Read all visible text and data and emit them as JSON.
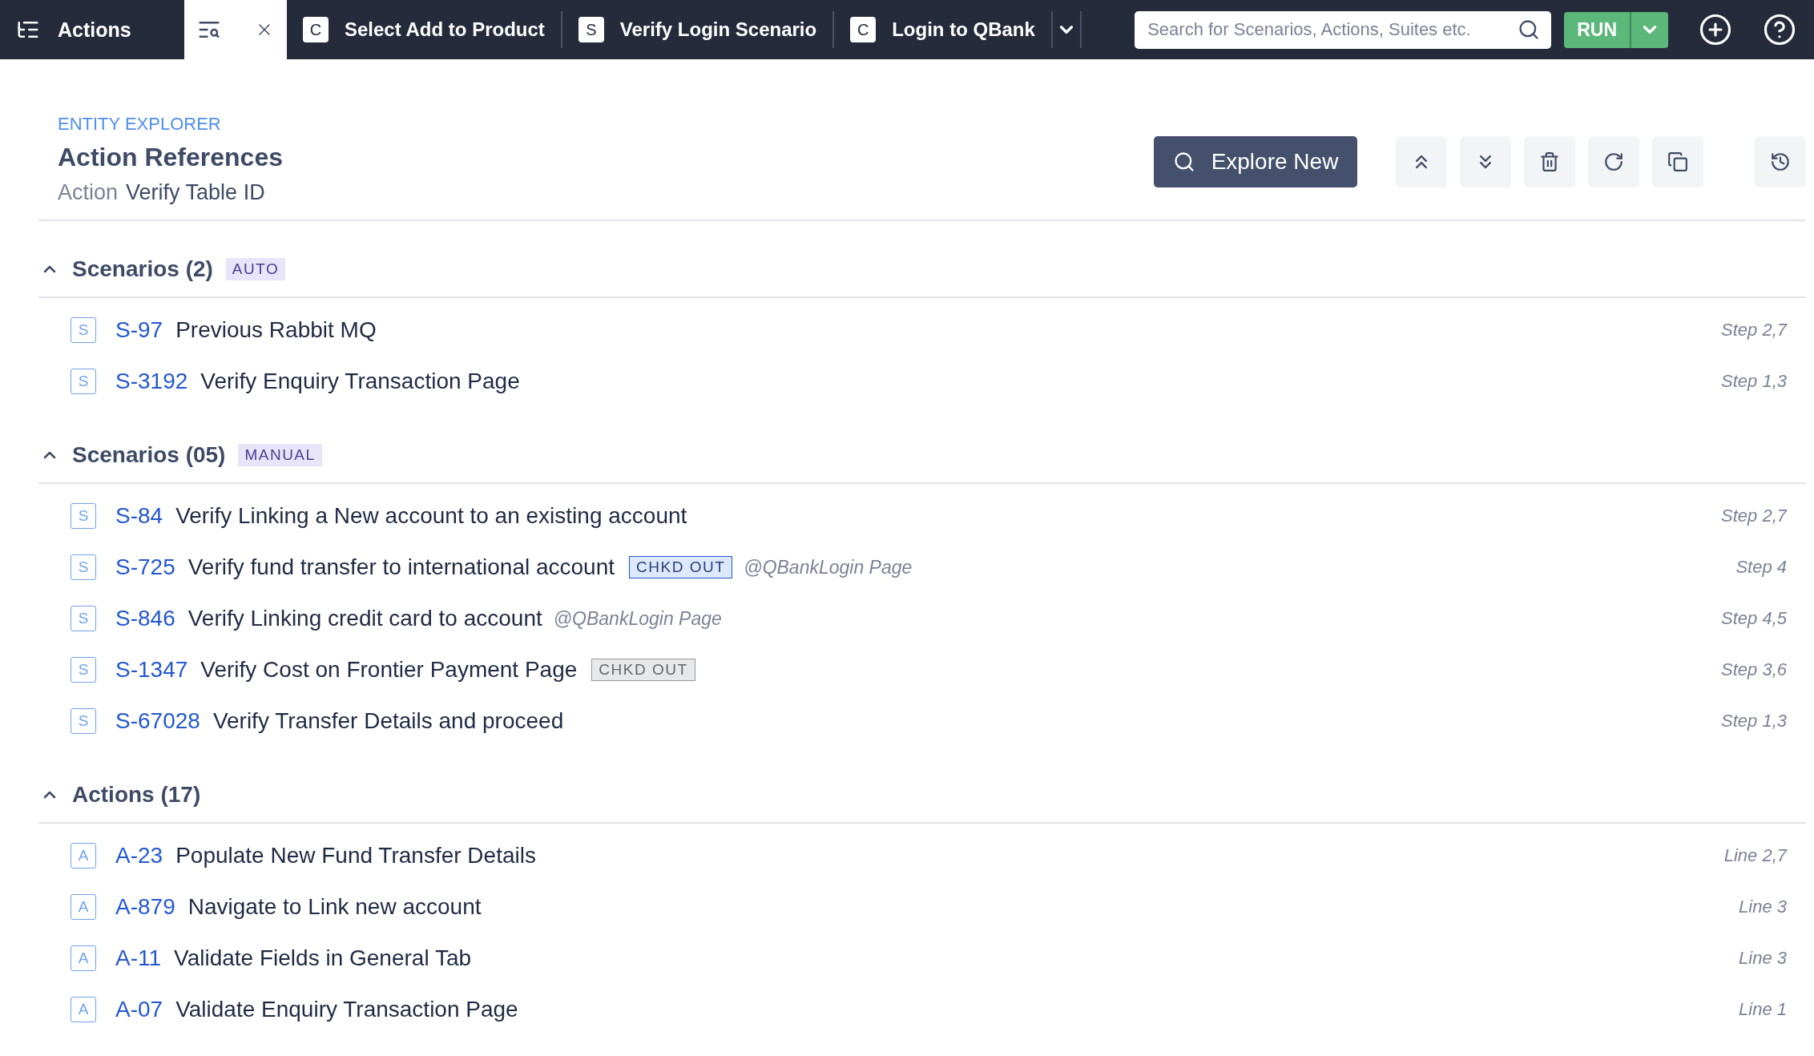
{
  "top_bar": {
    "menu": {
      "label": "Actions"
    },
    "tabs": [
      {
        "kind": "explorer",
        "selected": true
      },
      {
        "kind": "entity",
        "badge": "C",
        "label": "Select Add to Product",
        "selected": false
      },
      {
        "kind": "entity",
        "badge": "S",
        "label": "Verify Login Scenario",
        "selected": false
      },
      {
        "kind": "entity",
        "badge": "C",
        "label": "Login to QBank",
        "selected": false
      }
    ],
    "search": {
      "placeholder": "Search for Scenarios, Actions, Suites etc."
    },
    "run_button": {
      "label": "RUN"
    }
  },
  "header": {
    "eyebrow": "ENTITY EXPLORER",
    "title": "Action References",
    "subtitle_label": "Action",
    "subtitle_value": "Verify Table ID",
    "explore_button": {
      "label": "Explore New"
    },
    "tools": [
      {
        "kind": "collapse"
      },
      {
        "kind": "expand"
      },
      {
        "kind": "delete"
      },
      {
        "kind": "refresh"
      },
      {
        "kind": "duplicate"
      },
      {
        "kind": "history"
      }
    ]
  },
  "sections": [
    {
      "title": "Scenarios (2)",
      "tag": "AUTO",
      "expanded": true,
      "items": [
        {
          "badge": "S",
          "id": "S-97",
          "name": "Previous Rabbit MQ",
          "location": "Step 2,7"
        },
        {
          "badge": "S",
          "id": "S-3192",
          "name": "Verify Enquiry Transaction Page",
          "location": "Step 1,3"
        }
      ]
    },
    {
      "title": "Scenarios (05)",
      "tag": "MANUAL",
      "expanded": true,
      "items": [
        {
          "badge": "S",
          "id": "S-84",
          "name": "Verify Linking a New account to an existing account",
          "location": "Step 2,7"
        },
        {
          "badge": "S",
          "id": "S-725",
          "name": "Verify fund transfer to international account",
          "status": {
            "label": "CHKD OUT",
            "kind": "mine"
          },
          "context": "@QBankLogin Page",
          "location": "Step 4"
        },
        {
          "badge": "S",
          "id": "S-846",
          "name": "Verify Linking credit card to account",
          "context": "@QBankLogin Page",
          "location": "Step 4,5"
        },
        {
          "badge": "S",
          "id": "S-1347",
          "name": "Verify Cost on Frontier Payment Page",
          "status": {
            "label": "CHKD OUT",
            "kind": "other"
          },
          "location": "Step 3,6"
        },
        {
          "badge": "S",
          "id": "S-67028",
          "name": "Verify Transfer Details and proceed",
          "location": "Step 1,3"
        }
      ]
    },
    {
      "title": "Actions (17)",
      "expanded": true,
      "items": [
        {
          "badge": "A",
          "id": "A-23",
          "name": "Populate New Fund Transfer Details",
          "location": "Line 2,7"
        },
        {
          "badge": "A",
          "id": "A-879",
          "name": "Navigate to Link new account",
          "location": "Line 3"
        },
        {
          "badge": "A",
          "id": "A-11",
          "name": "Validate Fields in General Tab",
          "location": "Line 3"
        },
        {
          "badge": "A",
          "id": "A-07",
          "name": "Validate Enquiry Transaction Page",
          "location": "Line 1"
        }
      ]
    }
  ]
}
